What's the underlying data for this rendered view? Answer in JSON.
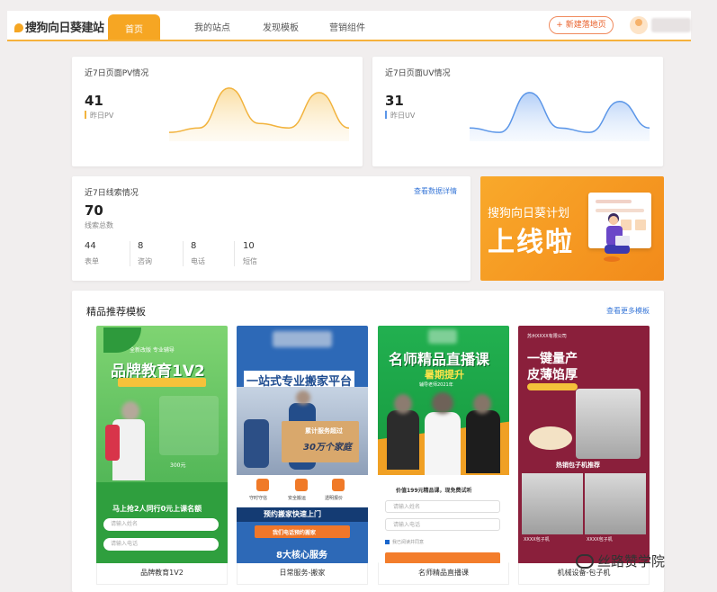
{
  "app": {
    "logo": "搜狗向日葵建站"
  },
  "nav": {
    "tabs": [
      "首页",
      "我的站点",
      "发现模板",
      "营销组件"
    ],
    "active": 0
  },
  "header": {
    "new_button": "+ 新建落地页"
  },
  "pv": {
    "title": "近7日页面PV情况",
    "value": "41",
    "label": "昨日PV",
    "trend": [
      2,
      3,
      12,
      4,
      3,
      11,
      3
    ]
  },
  "uv": {
    "title": "近7日页面UV情况",
    "value": "31",
    "label": "昨日UV",
    "trend": [
      3,
      2,
      11,
      3,
      2,
      9,
      3
    ]
  },
  "leads": {
    "title": "近7日线索情况",
    "link": "查看数据详情",
    "value": "70",
    "label": "线索总数",
    "stats": [
      {
        "value": "44",
        "label": "表单"
      },
      {
        "value": "8",
        "label": "咨询"
      },
      {
        "value": "8",
        "label": "电话"
      },
      {
        "value": "10",
        "label": "短信"
      }
    ]
  },
  "banner": {
    "line1": "搜狗向日葵计划",
    "line2": "上线啦"
  },
  "templates": {
    "title": "精品推荐模板",
    "more": "查看更多模板",
    "items": [
      {
        "caption": "品牌教育1V2",
        "heading": "品牌教育1V2",
        "kicker": "全新改版 专业辅导",
        "cta": "马上抢2人同行0元上课名额",
        "badge": "300元",
        "fields": [
          "请输入姓名",
          "请输入电话"
        ],
        "colors": [
          "#5cc35a",
          "#2f9f3e"
        ]
      },
      {
        "caption": "日常服务-搬家",
        "heading": "一站式专业搬家平台",
        "sub": "累计服务超过",
        "sub2": "30万个家庭",
        "icons": [
          "守时守信",
          "安全搬运",
          "透明报价"
        ],
        "cta": "预约搬家快速上门",
        "cta2": "我们电话预约搬家",
        "foot": "8大核心服务",
        "colors": [
          "#2d69b7",
          "#1f4d91"
        ]
      },
      {
        "caption": "名师精品直播课",
        "heading": "名师精品直播课",
        "sub": "暑期提升",
        "sub2": "辅导老师2021年",
        "cta": "价值199元精品课，现免费试听",
        "fields": [
          "请输入姓名",
          "请输入电话"
        ],
        "check": "我已阅读并同意",
        "colors": [
          "#19a043",
          "#0d7d30"
        ]
      },
      {
        "caption": "机械设备-包子机",
        "heading": "一键量产",
        "heading2": "皮薄馅厚",
        "corp": "苏州XXXX有限公司",
        "tag": "热销包子机推荐",
        "prod": [
          "XXXX包子机",
          "XXXX包子机"
        ],
        "colors": [
          "#8a1f3b",
          "#6d1530"
        ]
      }
    ]
  },
  "watermark": "丝路赞学院",
  "colors": {
    "accent": "#f6a623",
    "pv_line": "#f2b33d",
    "uv_line": "#5b96e8",
    "link": "#3a78d8"
  }
}
